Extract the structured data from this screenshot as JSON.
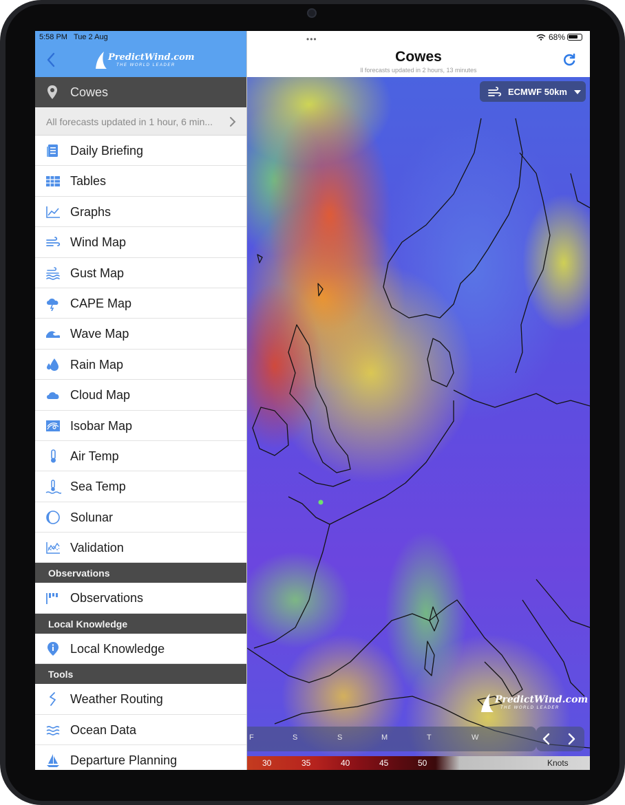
{
  "status_bar": {
    "time": "5:58 PM",
    "date": "Tue 2 Aug",
    "battery": "68%",
    "multitask_dots": "•••"
  },
  "sidebar": {
    "logo_main": "PredictWind.com",
    "logo_sub": "THE WORLD LEADER",
    "location": "Cowes",
    "update_notice": "All forecasts updated in 1 hour, 6 min...",
    "items": [
      {
        "label": "Daily Briefing",
        "icon": "newspaper-icon"
      },
      {
        "label": "Tables",
        "icon": "table-icon"
      },
      {
        "label": "Graphs",
        "icon": "line-graph-icon"
      },
      {
        "label": "Wind Map",
        "icon": "wind-icon"
      },
      {
        "label": "Gust Map",
        "icon": "gust-icon"
      },
      {
        "label": "CAPE Map",
        "icon": "thunderstorm-icon"
      },
      {
        "label": "Wave Map",
        "icon": "wave-icon"
      },
      {
        "label": "Rain Map",
        "icon": "raindrop-icon"
      },
      {
        "label": "Cloud Map",
        "icon": "cloud-icon"
      },
      {
        "label": "Isobar Map",
        "icon": "isobar-icon"
      },
      {
        "label": "Air Temp",
        "icon": "thermometer-icon"
      },
      {
        "label": "Sea Temp",
        "icon": "sea-temp-icon"
      },
      {
        "label": "Solunar",
        "icon": "moon-phase-icon"
      },
      {
        "label": "Validation",
        "icon": "validation-chart-icon"
      }
    ],
    "sections": [
      {
        "title": "Observations",
        "items": [
          {
            "label": "Observations",
            "icon": "flags-icon"
          }
        ]
      },
      {
        "title": "Local Knowledge",
        "items": [
          {
            "label": "Local Knowledge",
            "icon": "info-pin-icon"
          }
        ]
      },
      {
        "title": "Tools",
        "items": [
          {
            "label": "Weather Routing",
            "icon": "route-icon"
          },
          {
            "label": "Ocean Data",
            "icon": "ocean-waves-icon"
          },
          {
            "label": "Departure Planning",
            "icon": "sailboat-icon"
          }
        ]
      }
    ]
  },
  "main": {
    "title": "Cowes",
    "subtitle": "ll forecasts updated in 2 hours, 13 minutes"
  },
  "map": {
    "model": "ECMWF 50km",
    "watermark_main": "PredictWind.com",
    "watermark_sub": "THE WORLD LEADER",
    "timeline_days": [
      "F",
      "S",
      "S",
      "M",
      "T",
      "W"
    ],
    "legend_values": [
      "30",
      "35",
      "40",
      "45",
      "50"
    ],
    "legend_unit": "Knots"
  },
  "colors": {
    "header_blue": "#5aa2f0",
    "icon_blue": "#4f8fe8",
    "section_dark": "#4a4a4a",
    "refresh_blue": "#2f7be6"
  }
}
